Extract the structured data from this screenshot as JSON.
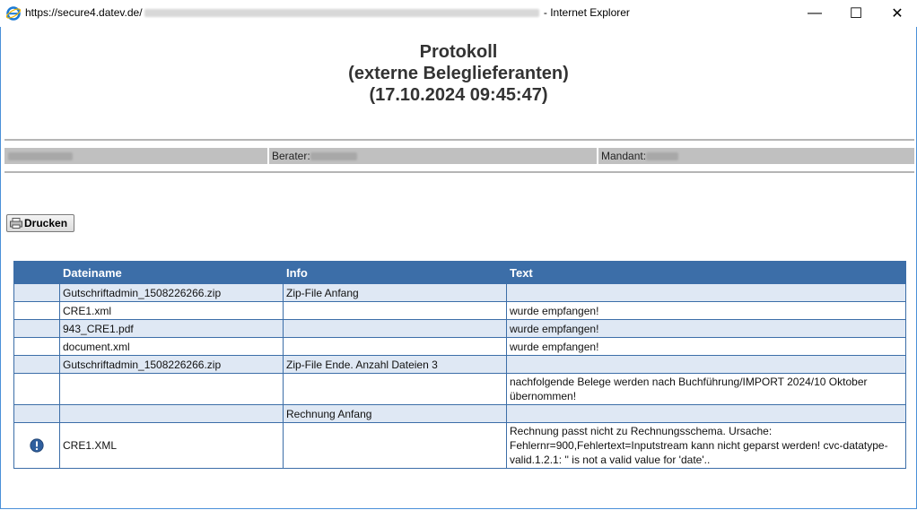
{
  "window": {
    "url_prefix": "https://secure4.datev.de/",
    "browser_name": "- Internet Explorer",
    "controls": {
      "minimize": "—",
      "maximize": "☐",
      "close": "✕"
    }
  },
  "heading": {
    "line1": "Protokoll",
    "line2": "(externe Beleglieferanten)",
    "line3": "(17.10.2024  09:45:47)"
  },
  "info_bar": {
    "berater_label": "Berater:",
    "mandant_label": "Mandant:"
  },
  "print_button": {
    "label": "Drucken"
  },
  "table": {
    "headers": [
      "",
      "Dateiname",
      "Info",
      "Text"
    ],
    "rows": [
      {
        "icon": "",
        "file": "Gutschriftadmin_1508226266.zip",
        "info": "Zip-File Anfang",
        "text": ""
      },
      {
        "icon": "",
        "file": "CRE1.xml",
        "info": "",
        "text": "wurde empfangen!"
      },
      {
        "icon": "",
        "file": "943_CRE1.pdf",
        "info": "",
        "text": "wurde empfangen!"
      },
      {
        "icon": "",
        "file": "document.xml",
        "info": "",
        "text": "wurde empfangen!"
      },
      {
        "icon": "",
        "file": "Gutschriftadmin_1508226266.zip",
        "info": "Zip-File Ende. Anzahl Dateien 3",
        "text": ""
      },
      {
        "icon": "",
        "file": "",
        "info": "",
        "text": "nachfolgende Belege werden nach Buchführung/IMPORT 2024/10 Oktober übernommen!"
      },
      {
        "icon": "",
        "file": "",
        "info": "Rechnung Anfang",
        "text": ""
      },
      {
        "icon": "warning-icon",
        "file": "CRE1.XML",
        "info": "",
        "text": "Rechnung passt nicht zu Rechnungsschema. Ursache: Fehlernr=900,Fehlertext=Inputstream kann nicht geparst werden! cvc-datatype-valid.1.2.1: '' is not a valid value for 'date'.."
      }
    ]
  },
  "colors": {
    "header_blue": "#3c6ea8",
    "row_alt": "#dfe8f4",
    "info_bar": "#c0c0c0"
  }
}
